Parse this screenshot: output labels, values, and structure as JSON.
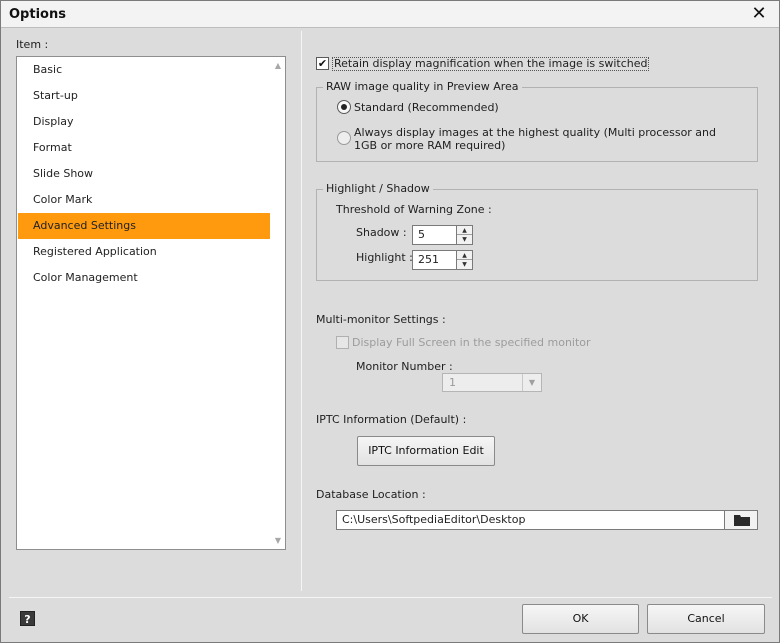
{
  "window": {
    "title": "Options",
    "close_glyph": "✕"
  },
  "left_panel": {
    "label": "Item :",
    "items": [
      {
        "label": "Basic"
      },
      {
        "label": "Start-up"
      },
      {
        "label": "Display"
      },
      {
        "label": "Format"
      },
      {
        "label": "Slide Show"
      },
      {
        "label": "Color Mark"
      },
      {
        "label": "Advanced Settings",
        "selected": true
      },
      {
        "label": "Registered Application"
      },
      {
        "label": "Color Management"
      }
    ]
  },
  "retain_magnification": {
    "label": "Retain display magnification when the image is switched",
    "checked": true
  },
  "raw_quality": {
    "title": "RAW image quality in Preview Area",
    "options": [
      {
        "label": "Standard (Recommended)",
        "selected": true
      },
      {
        "label": "Always display images at the highest quality (Multi processor and 1GB or more RAM required)",
        "selected": false
      }
    ]
  },
  "highlight_shadow": {
    "title": "Highlight / Shadow",
    "threshold_label": "Threshold of Warning Zone :",
    "shadow_label": "Shadow :",
    "shadow_value": "5",
    "highlight_label": "Highlight :",
    "highlight_value": "251"
  },
  "multi_monitor": {
    "label": "Multi-monitor Settings :",
    "fullscreen_label": "Display Full Screen in the specified monitor",
    "fullscreen_checked": false,
    "monitor_number_label": "Monitor Number :",
    "monitor_number_value": "1"
  },
  "iptc": {
    "label": "IPTC Information (Default) :",
    "button_label": "IPTC Information Edit"
  },
  "database": {
    "label": "Database Location :",
    "path": "C:\\Users\\SoftpediaEditor\\Desktop"
  },
  "footer": {
    "help_label": "?",
    "ok_label": "OK",
    "cancel_label": "Cancel"
  },
  "colors": {
    "selected_item": "#ff9a0e",
    "dialog_bg": "#dcdcdc"
  },
  "icons": [
    "close-icon",
    "scroll-up-icon",
    "scroll-down-icon",
    "checkmark-icon",
    "spin-up-icon",
    "spin-down-icon",
    "chevron-down-icon",
    "folder-icon",
    "help-icon"
  ]
}
